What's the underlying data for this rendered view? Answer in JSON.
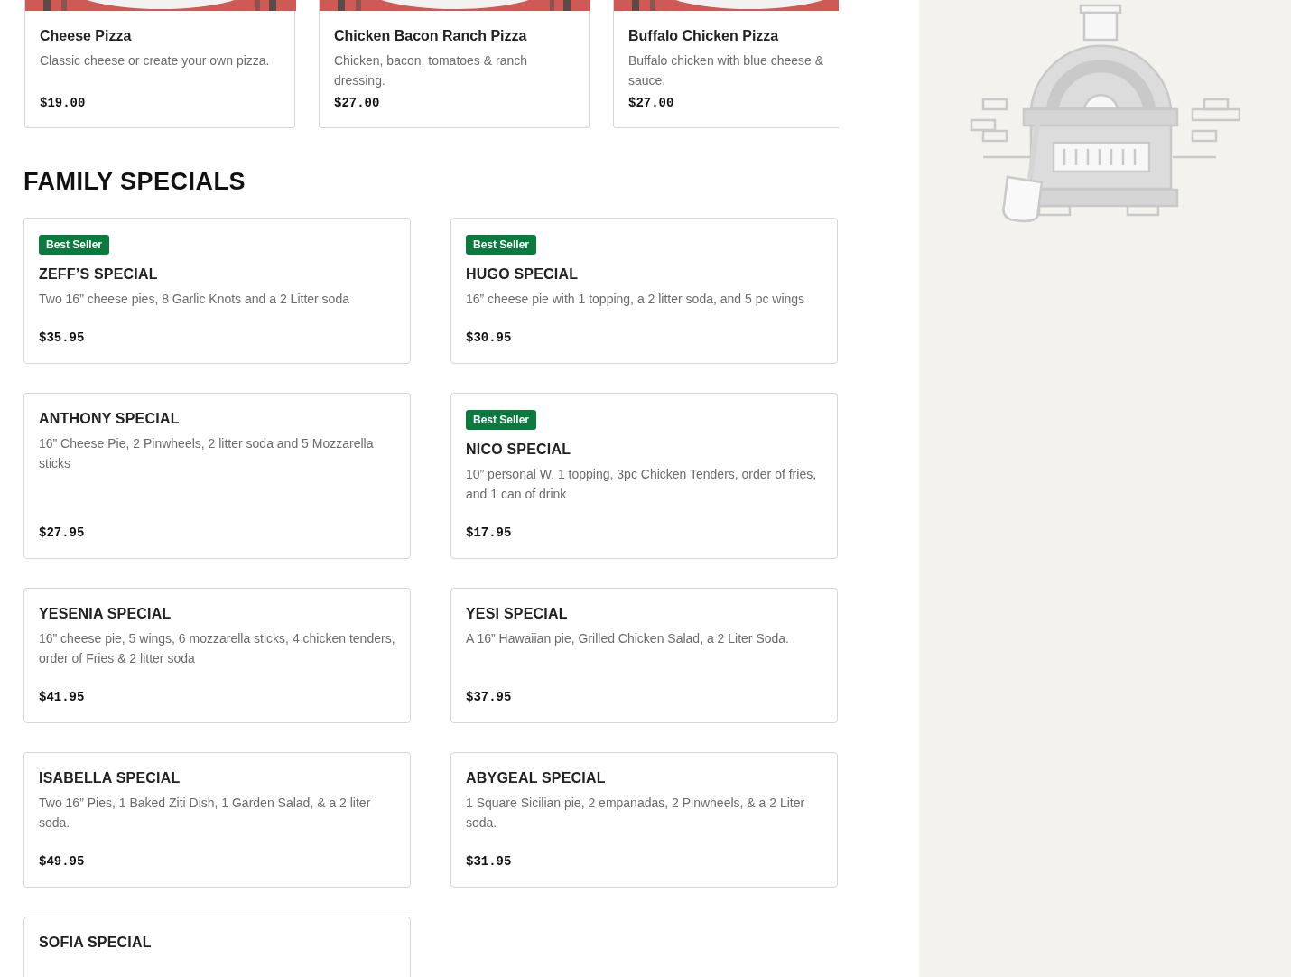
{
  "featured_items": [
    {
      "name": "Cheese Pizza",
      "description": "Classic cheese or create your own pizza.",
      "price": "$19.00"
    },
    {
      "name": "Chicken Bacon Ranch Pizza",
      "description": "Chicken, bacon, tomatoes & ranch dressing.",
      "price": "$27.00"
    },
    {
      "name": "Buffalo Chicken Pizza",
      "description": "Buffalo chicken with blue cheese &\nsauce.",
      "price": "$27.00"
    }
  ],
  "section": {
    "title": "FAMILY SPECIALS"
  },
  "specials": [
    {
      "badge": "Best Seller",
      "name": "ZEFF’S SPECIAL",
      "description": "Two 16” cheese pies, 8 Garlic Knots and a 2 Litter soda",
      "price": "$35.95"
    },
    {
      "badge": "Best Seller",
      "name": "HUGO SPECIAL",
      "description": "16” cheese pie with 1 topping, a 2 litter soda, and 5 pc wings",
      "price": "$30.95"
    },
    {
      "name": "ANTHONY SPECIAL",
      "description": "16” Cheese Pie, 2 Pinwheels, 2 litter soda and 5 Mozzarella sticks",
      "price": "$27.95"
    },
    {
      "badge": "Best Seller",
      "name": "NICO SPECIAL",
      "description": "10” personal W. 1 topping, 3pc Chicken Tenders, order of fries, and 1 can of drink",
      "price": "$17.95"
    },
    {
      "name": "YESENIA SPECIAL",
      "description": "16” cheese pie, 5 wings, 6 mozzarella sticks, 4 chicken tenders, order of Fries & 2 litter soda",
      "price": "$41.95"
    },
    {
      "name": "YESI SPECIAL",
      "description": "A 16” Hawaiian pie, Grilled Chicken Salad, a 2 Liter Soda.",
      "price": "$37.95"
    },
    {
      "name": "ISABELLA SPECIAL",
      "description": "Two 16” Pies, 1 Baked Ziti Dish, 1 Garden Salad, & a 2 liter soda.",
      "price": "$49.95"
    },
    {
      "name": "ABYGEAL SPECIAL",
      "description": "1 Square Sicilian pie, 2 empanadas, 2 Pinwheels, & a 2 Liter soda.",
      "price": "$31.95"
    },
    {
      "name": "SOFIA SPECIAL"
    }
  ]
}
